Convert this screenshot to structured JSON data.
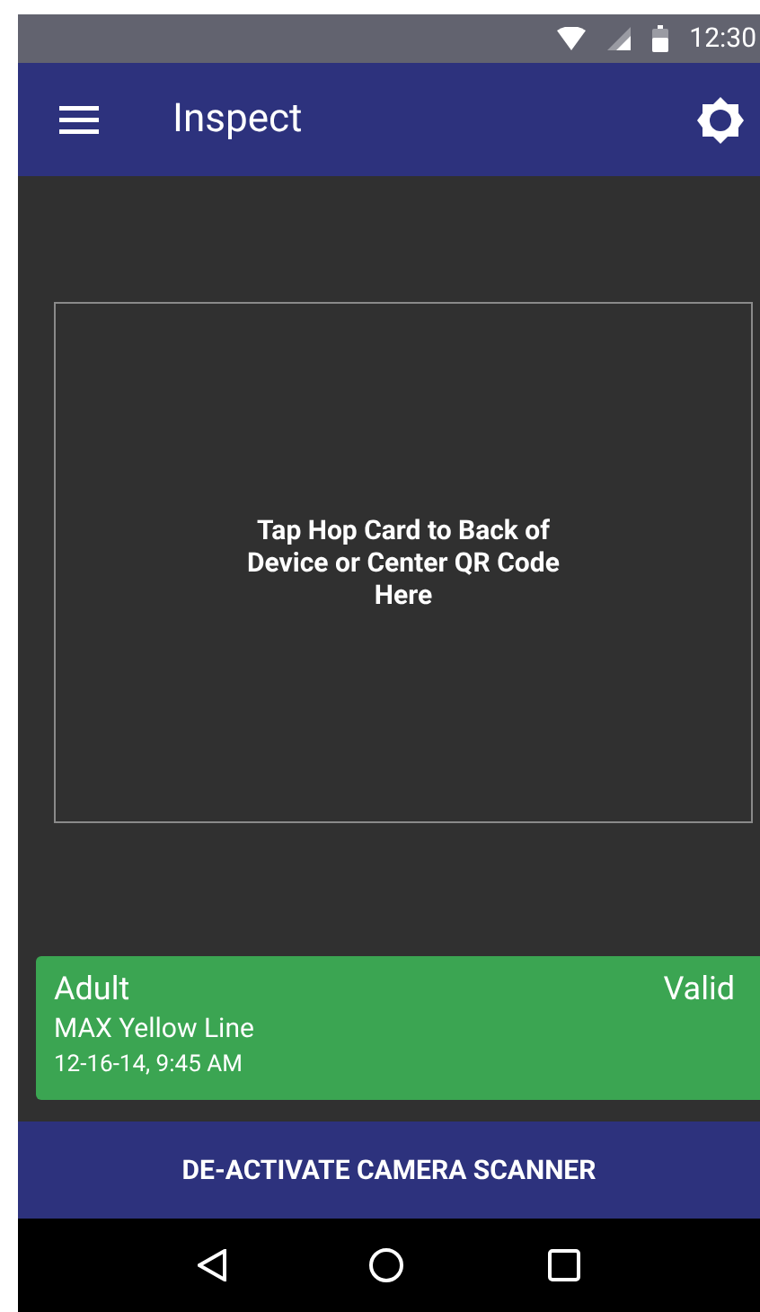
{
  "status_bar": {
    "time": "12:30"
  },
  "app_bar": {
    "title": "Inspect"
  },
  "scanner": {
    "prompt": "Tap Hop Card to Back of Device or Center QR Code Here"
  },
  "result": {
    "fare_type": "Adult",
    "status": "Valid",
    "line": "MAX Yellow Line",
    "timestamp": "12-16-14, 9:45 AM",
    "color": "#3ba552"
  },
  "action_button": {
    "label": "DE-ACTIVATE CAMERA SCANNER"
  }
}
